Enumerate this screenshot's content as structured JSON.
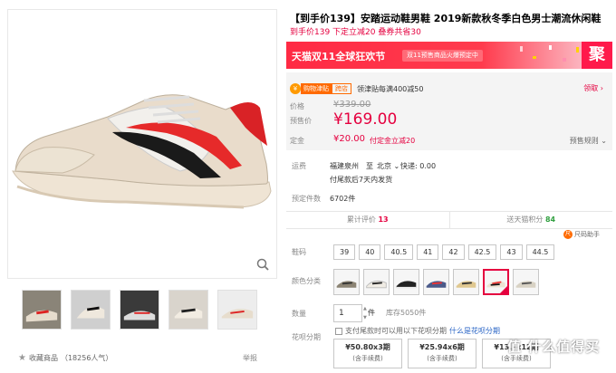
{
  "gallery": {
    "favorite_label": "收藏商品",
    "favorite_count": "（18256人气）",
    "report_label": "举报"
  },
  "product": {
    "title": "【到手价139】安踏运动鞋男鞋 2019新款秋冬季白色男士潮流休闲鞋",
    "subtitle": "到手价139 下定立减20 叠券共省30"
  },
  "banner": {
    "tmall_label": "天猫双11全球狂欢节",
    "presale_pill": "双11预售商品火爆预定中",
    "ju_label": "聚"
  },
  "price": {
    "coupon_tag_a": "购物津贴",
    "coupon_tag_b": "跨店",
    "coupon_text": "领津贴每满400减50",
    "collect_label": "领取",
    "price_label": "价格",
    "original_price": "¥339.00",
    "presale_label": "预售价",
    "presale_price": "¥169.00",
    "deposit_label": "定金",
    "deposit_price": "¥20.00",
    "deposit_note": "付定金立减20",
    "rules_label": "预售规则"
  },
  "shipping": {
    "label": "运费",
    "from": "福建泉州",
    "to_word": "至",
    "to": "北京",
    "express": "快递: 0.00",
    "ship_note": "付尾款后7天内发货"
  },
  "presale_count": {
    "label": "预定件数",
    "value": "6702件"
  },
  "stats": {
    "reviews_label": "累计评价",
    "reviews_count": "13",
    "points_label": "送天猫积分",
    "points_value": "84"
  },
  "size_helper": "尺码助手",
  "sizes": {
    "label": "鞋码",
    "options": [
      "39",
      "40",
      "40.5",
      "41",
      "42",
      "42.5",
      "43",
      "44.5"
    ]
  },
  "colors": {
    "label": "颜色分类",
    "selected_index": 5
  },
  "quantity": {
    "label": "数量",
    "value": "1",
    "unit": "件",
    "stock": "库存5050件"
  },
  "huabei": {
    "label": "花呗分期",
    "note": "支付尾款时可以用以下花呗分期",
    "link": "什么是花呗分期",
    "options": [
      {
        "amount": "¥50.80x3期",
        "fee": "(含手续费)"
      },
      {
        "amount": "¥25.94x6期",
        "fee": "(含手续费)"
      },
      {
        "amount": "¥13.xx12期",
        "fee": "(含手续费)"
      }
    ]
  },
  "watermark": "值 什么值得买",
  "colors_hex": {
    "accent": "#e5003f",
    "banner": "#ff2a44"
  }
}
